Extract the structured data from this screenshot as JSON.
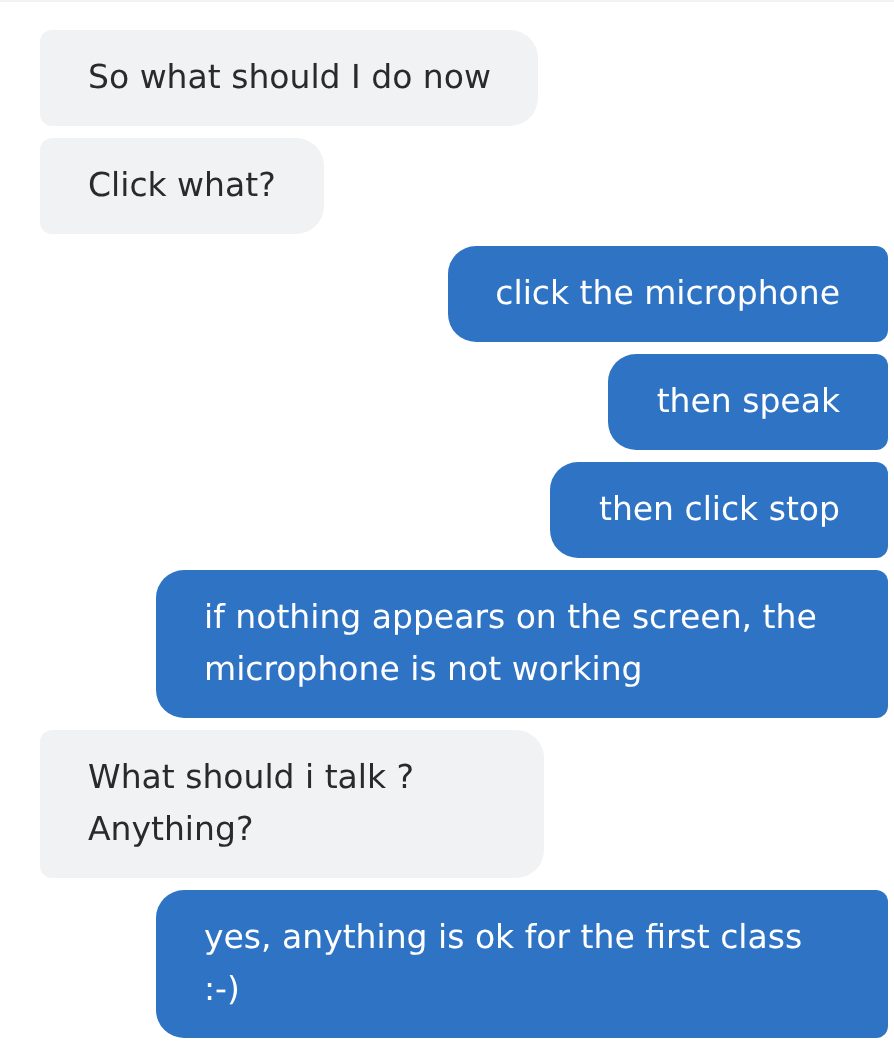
{
  "messages": [
    {
      "kind": "incoming",
      "text": "So what should I do now"
    },
    {
      "kind": "incoming",
      "text": "Click what?"
    },
    {
      "kind": "outgoing",
      "text": "click the microphone"
    },
    {
      "kind": "outgoing",
      "text": "then speak"
    },
    {
      "kind": "outgoing",
      "text": "then click stop"
    },
    {
      "kind": "outgoing",
      "text": "if nothing appears on the screen, the microphone is not working"
    },
    {
      "kind": "incoming",
      "text": "What should i talk ? Anything?"
    },
    {
      "kind": "outgoing",
      "text": "yes, anything is ok for the first class :-)"
    }
  ]
}
